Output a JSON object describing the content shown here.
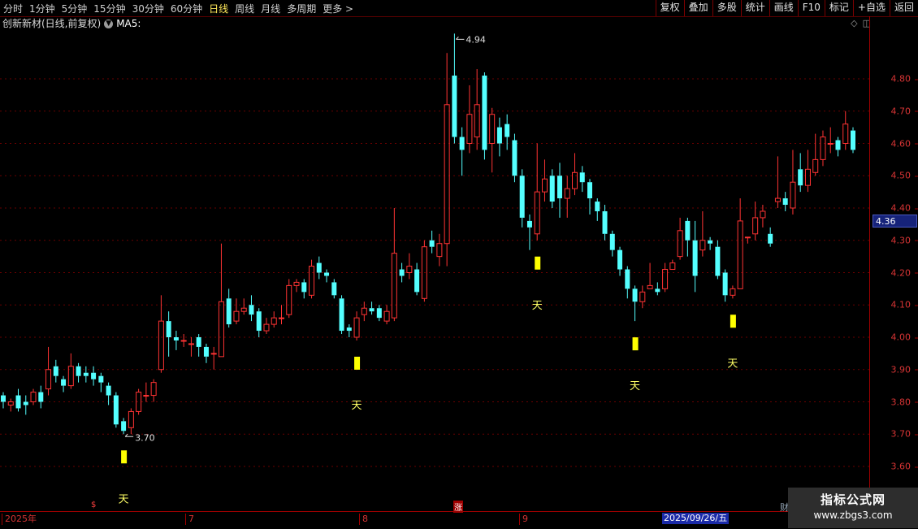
{
  "toolbar": {
    "periods": [
      "分时",
      "1分钟",
      "5分钟",
      "15分钟",
      "30分钟",
      "60分钟",
      "日线",
      "周线",
      "月线",
      "多周期",
      "更多 >"
    ],
    "active_period": "日线",
    "tools": [
      "复权",
      "叠加",
      "多股",
      "统计",
      "画线",
      "F10",
      "标记",
      "+自选",
      "返回"
    ]
  },
  "info": {
    "title": "创新新材(日线,前复权)",
    "ma_label": "MA5:",
    "icons": [
      "diamond-icon",
      "window-icon"
    ]
  },
  "price_axis": {
    "ticks": [
      "4.80",
      "4.70",
      "4.60",
      "4.50",
      "4.40",
      "4.30",
      "4.20",
      "4.10",
      "4.00",
      "3.90",
      "3.80",
      "3.70",
      "3.60"
    ],
    "current_price": "4.36"
  },
  "annotations": {
    "high": "4.94",
    "low": "3.70",
    "signal_char": "天"
  },
  "time_axis": {
    "labels": [
      "2025年",
      "7",
      "8",
      "9"
    ],
    "highlight_date": "2025/09/26/五",
    "marks": [
      "$",
      "涨",
      "财"
    ]
  },
  "watermark": {
    "line1": "指标公式网",
    "line2": "www.zbgs3.com"
  },
  "colors": {
    "up": "#ff3333",
    "down": "#54ffff",
    "grid": "#6a0000",
    "signal": "#ffff00",
    "axis": "#d63434",
    "highlight": "#1a2aa8"
  },
  "chart_data": {
    "type": "candlestick",
    "ylim": [
      3.55,
      4.95
    ],
    "ohlc": [
      [
        3.82,
        3.8,
        3.83,
        3.78
      ],
      [
        3.79,
        3.8,
        3.81,
        3.77
      ],
      [
        3.82,
        3.78,
        3.84,
        3.77
      ],
      [
        3.8,
        3.79,
        3.82,
        3.76
      ],
      [
        3.8,
        3.83,
        3.84,
        3.79
      ],
      [
        3.83,
        3.8,
        3.85,
        3.78
      ],
      [
        3.84,
        3.9,
        3.97,
        3.82
      ],
      [
        3.91,
        3.88,
        3.93,
        3.86
      ],
      [
        3.87,
        3.85,
        3.88,
        3.83
      ],
      [
        3.85,
        3.91,
        3.95,
        3.84
      ],
      [
        3.91,
        3.88,
        3.92,
        3.86
      ],
      [
        3.89,
        3.88,
        3.91,
        3.86
      ],
      [
        3.89,
        3.87,
        3.91,
        3.85
      ],
      [
        3.88,
        3.86,
        3.89,
        3.83
      ],
      [
        3.85,
        3.82,
        3.86,
        3.79
      ],
      [
        3.82,
        3.73,
        3.83,
        3.72
      ],
      [
        3.74,
        3.71,
        3.75,
        3.7
      ],
      [
        3.72,
        3.77,
        3.78,
        3.7
      ],
      [
        3.77,
        3.83,
        3.84,
        3.76
      ],
      [
        3.82,
        3.82,
        3.86,
        3.8
      ],
      [
        3.82,
        3.86,
        3.87,
        3.8
      ],
      [
        3.9,
        4.05,
        4.13,
        3.89
      ],
      [
        4.05,
        4.0,
        4.08,
        3.94
      ],
      [
        4.0,
        3.99,
        4.02,
        3.96
      ],
      [
        3.99,
        3.99,
        4.01,
        3.97
      ],
      [
        3.98,
        3.98,
        4.0,
        3.94
      ],
      [
        4.0,
        3.97,
        4.01,
        3.94
      ],
      [
        3.97,
        3.94,
        3.98,
        3.92
      ],
      [
        3.95,
        3.95,
        3.97,
        3.9
      ],
      [
        3.94,
        4.11,
        4.29,
        3.94
      ],
      [
        4.12,
        4.04,
        4.15,
        4.03
      ],
      [
        4.05,
        4.08,
        4.12,
        4.04
      ],
      [
        4.08,
        4.09,
        4.12,
        4.07
      ],
      [
        4.1,
        4.07,
        4.13,
        4.05
      ],
      [
        4.08,
        4.02,
        4.09,
        4.0
      ],
      [
        4.02,
        4.04,
        4.06,
        4.01
      ],
      [
        4.04,
        4.06,
        4.08,
        4.03
      ],
      [
        4.06,
        4.06,
        4.1,
        4.04
      ],
      [
        4.07,
        4.16,
        4.18,
        4.06
      ],
      [
        4.16,
        4.17,
        4.18,
        4.14
      ],
      [
        4.17,
        4.14,
        4.18,
        4.12
      ],
      [
        4.13,
        4.22,
        4.24,
        4.12
      ],
      [
        4.23,
        4.2,
        4.25,
        4.18
      ],
      [
        4.2,
        4.19,
        4.21,
        4.17
      ],
      [
        4.17,
        4.13,
        4.18,
        4.12
      ],
      [
        4.12,
        4.02,
        4.13,
        4.01
      ],
      [
        4.03,
        4.02,
        4.04,
        4.0
      ],
      [
        4.0,
        4.06,
        4.08,
        3.99
      ],
      [
        4.07,
        4.09,
        4.11,
        4.05
      ],
      [
        4.09,
        4.08,
        4.11,
        4.07
      ],
      [
        4.09,
        4.06,
        4.1,
        4.05
      ],
      [
        4.05,
        4.08,
        4.1,
        4.04
      ],
      [
        4.06,
        4.26,
        4.4,
        4.05
      ],
      [
        4.21,
        4.19,
        4.23,
        4.17
      ],
      [
        4.2,
        4.22,
        4.26,
        4.18
      ],
      [
        4.21,
        4.14,
        4.23,
        4.13
      ],
      [
        4.12,
        4.28,
        4.3,
        4.11
      ],
      [
        4.3,
        4.28,
        4.33,
        4.26
      ],
      [
        4.25,
        4.29,
        4.32,
        4.22
      ],
      [
        4.29,
        4.72,
        4.88,
        4.22
      ],
      [
        4.81,
        4.62,
        4.94,
        4.6
      ],
      [
        4.62,
        4.58,
        4.65,
        4.5
      ],
      [
        4.6,
        4.69,
        4.78,
        4.57
      ],
      [
        4.62,
        4.72,
        4.83,
        4.58
      ],
      [
        4.81,
        4.58,
        4.82,
        4.55
      ],
      [
        4.6,
        4.69,
        4.71,
        4.51
      ],
      [
        4.65,
        4.6,
        4.68,
        4.56
      ],
      [
        4.66,
        4.62,
        4.69,
        4.58
      ],
      [
        4.61,
        4.5,
        4.63,
        4.48
      ],
      [
        4.5,
        4.37,
        4.52,
        4.34
      ],
      [
        4.36,
        4.34,
        4.38,
        4.27
      ],
      [
        4.32,
        4.45,
        4.6,
        4.3
      ],
      [
        4.45,
        4.49,
        4.55,
        4.42
      ],
      [
        4.5,
        4.42,
        4.52,
        4.4
      ],
      [
        4.5,
        4.43,
        4.54,
        4.37
      ],
      [
        4.43,
        4.46,
        4.5,
        4.37
      ],
      [
        4.46,
        4.51,
        4.57,
        4.44
      ],
      [
        4.51,
        4.48,
        4.53,
        4.45
      ],
      [
        4.48,
        4.43,
        4.49,
        4.38
      ],
      [
        4.42,
        4.39,
        4.43,
        4.36
      ],
      [
        4.39,
        4.32,
        4.41,
        4.3
      ],
      [
        4.32,
        4.27,
        4.33,
        4.25
      ],
      [
        4.27,
        4.21,
        4.28,
        4.19
      ],
      [
        4.21,
        4.15,
        4.22,
        4.12
      ],
      [
        4.15,
        4.11,
        4.16,
        4.05
      ],
      [
        4.11,
        4.14,
        4.16,
        4.09
      ],
      [
        4.15,
        4.16,
        4.23,
        4.15
      ],
      [
        4.15,
        4.14,
        4.17,
        4.13
      ],
      [
        4.15,
        4.21,
        4.23,
        4.14
      ],
      [
        4.21,
        4.23,
        4.24,
        4.21
      ],
      [
        4.25,
        4.33,
        4.37,
        4.24
      ],
      [
        4.36,
        4.3,
        4.37,
        4.25
      ],
      [
        4.3,
        4.19,
        4.36,
        4.14
      ],
      [
        4.27,
        4.3,
        4.39,
        4.25
      ],
      [
        4.3,
        4.29,
        4.31,
        4.27
      ],
      [
        4.28,
        4.19,
        4.3,
        4.18
      ],
      [
        4.2,
        4.13,
        4.21,
        4.11
      ],
      [
        4.13,
        4.15,
        4.16,
        4.12
      ],
      [
        4.15,
        4.36,
        4.43,
        4.15
      ],
      [
        4.31,
        4.31,
        4.31,
        4.29
      ],
      [
        4.32,
        4.37,
        4.42,
        4.3
      ],
      [
        4.37,
        4.39,
        4.41,
        4.34
      ],
      [
        4.32,
        4.29,
        4.34,
        4.28
      ],
      [
        4.42,
        4.43,
        4.56,
        4.4
      ],
      [
        4.43,
        4.41,
        4.45,
        4.39
      ],
      [
        4.4,
        4.48,
        4.58,
        4.38
      ],
      [
        4.52,
        4.47,
        4.57,
        4.45
      ],
      [
        4.47,
        4.52,
        4.58,
        4.45
      ],
      [
        4.51,
        4.55,
        4.63,
        4.5
      ],
      [
        4.55,
        4.62,
        4.64,
        4.53
      ],
      [
        4.6,
        4.6,
        4.65,
        4.57
      ],
      [
        4.61,
        4.58,
        4.62,
        4.56
      ],
      [
        4.6,
        4.66,
        4.7,
        4.58
      ],
      [
        4.64,
        4.58,
        4.65,
        4.57
      ]
    ],
    "signals": [
      16,
      47,
      71,
      84,
      97
    ],
    "signal_label": "天"
  }
}
